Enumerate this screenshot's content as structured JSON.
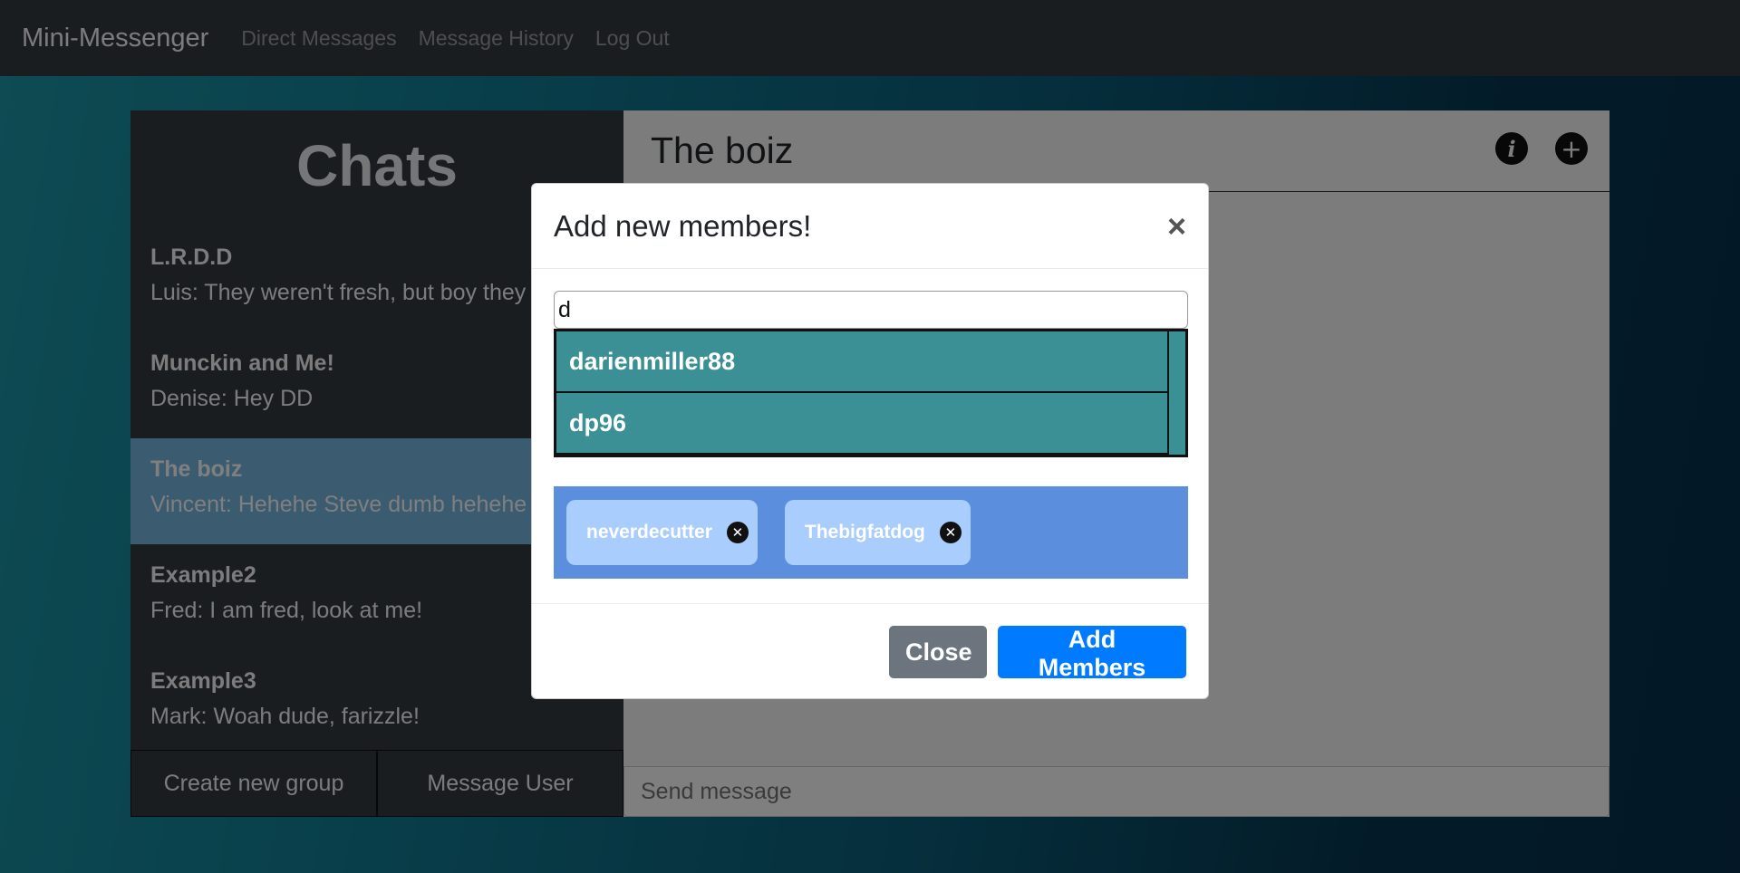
{
  "navbar": {
    "brand": "Mini-Messenger",
    "links": [
      "Direct Messages",
      "Message History",
      "Log Out"
    ]
  },
  "sidebar": {
    "title": "Chats",
    "chats": [
      {
        "name": "L.R.D.D",
        "preview": "Luis: They weren't fresh, but boy they were good!"
      },
      {
        "name": "Munckin and Me!",
        "preview": "Denise: Hey DD"
      },
      {
        "name": "The boiz",
        "preview": "Vincent: Hehehe Steve dumb hehehe"
      },
      {
        "name": "Example2",
        "preview": "Fred: I am fred, look at me!"
      },
      {
        "name": "Example3",
        "preview": "Mark: Woah dude, farizzle!"
      }
    ],
    "active_index": 2,
    "create_group_label": "Create new group",
    "message_user_label": "Message User"
  },
  "chat_panel": {
    "title": "The boiz",
    "info_icon": "info-icon",
    "add_icon": "plus-icon",
    "send_placeholder": "Send message"
  },
  "modal": {
    "title": "Add new members!",
    "search_value": "d",
    "suggestions": [
      "darienmiller88",
      "dp96"
    ],
    "selected_members": [
      "neverdecutter",
      "Thebigfatdog"
    ],
    "close_label": "Close",
    "add_label": "Add Members"
  },
  "colors": {
    "navbar": "#343a40",
    "suggestion_bg": "#3a9094",
    "chips_bg": "#5b8fdd",
    "primary": "#007bff",
    "secondary": "#6c757d"
  }
}
